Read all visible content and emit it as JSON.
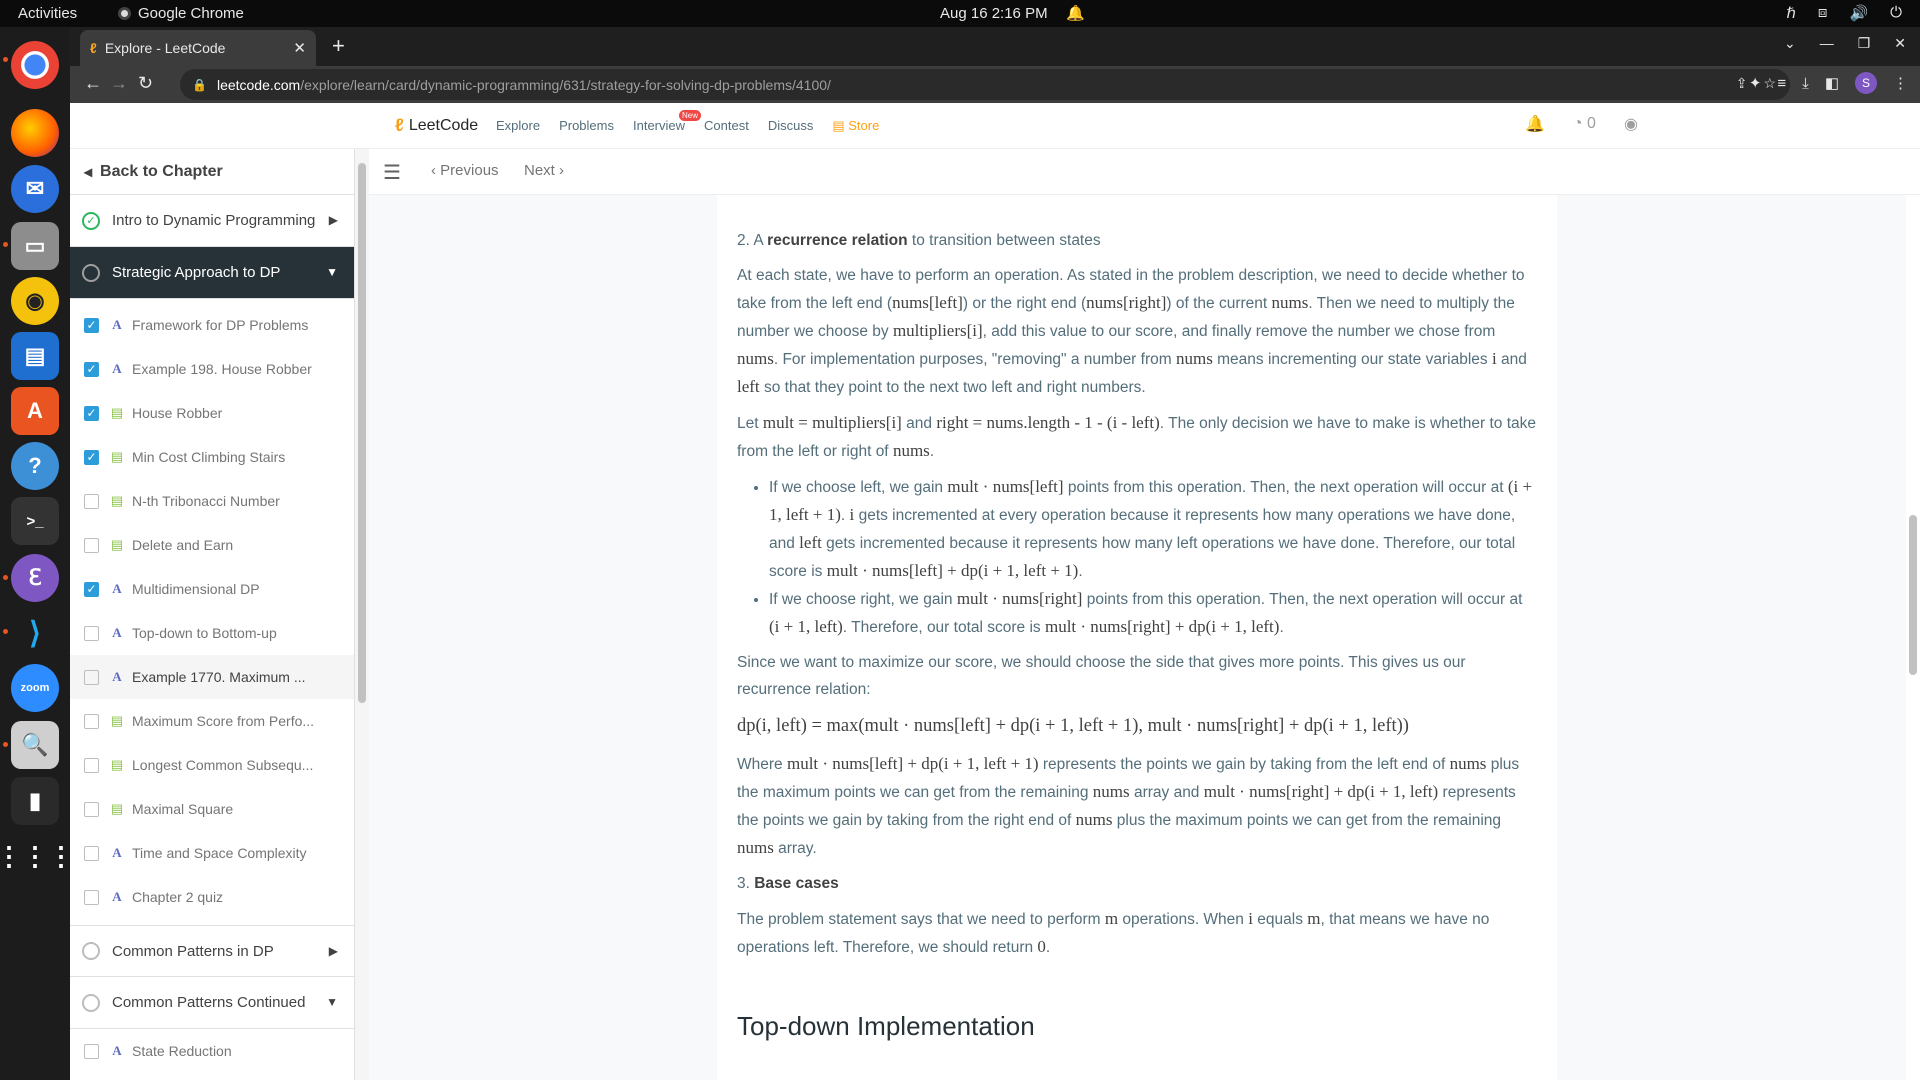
{
  "system": {
    "activities": "Activities",
    "app_name": "Google Chrome",
    "clock": "Aug 16  2:16 PM"
  },
  "browser": {
    "tab_title": "Explore - LeetCode",
    "url_host": "leetcode.com",
    "url_path": "/explore/learn/card/dynamic-programming/631/strategy-for-solving-dp-problems/4100/",
    "profile_initial": "S"
  },
  "lc_nav": {
    "logo": "LeetCode",
    "links": [
      "Explore",
      "Problems",
      "Interview",
      "Contest",
      "Discuss"
    ],
    "new_badge": "New",
    "store": "Store",
    "coin_count": "0"
  },
  "sidebar": {
    "back_label": "Back to Chapter",
    "chapters": [
      {
        "label": "Intro to Dynamic Programming",
        "status": "done",
        "expanded": false
      },
      {
        "label": "Strategic Approach to DP",
        "status": "in-progress",
        "expanded": true
      }
    ],
    "lessons": [
      {
        "label": "Framework for DP Problems",
        "checked": true,
        "type": "article"
      },
      {
        "label": "Example 198. House Robber",
        "checked": true,
        "type": "article"
      },
      {
        "label": "House Robber",
        "checked": true,
        "type": "doc"
      },
      {
        "label": "Min Cost Climbing Stairs",
        "checked": true,
        "type": "doc"
      },
      {
        "label": "N-th Tribonacci Number",
        "checked": false,
        "type": "doc"
      },
      {
        "label": "Delete and Earn",
        "checked": false,
        "type": "doc"
      },
      {
        "label": "Multidimensional DP",
        "checked": true,
        "type": "article"
      },
      {
        "label": "Top-down to Bottom-up",
        "checked": false,
        "type": "article"
      },
      {
        "label": "Example 1770. Maximum ...",
        "checked": false,
        "type": "article",
        "selected": true
      },
      {
        "label": "Maximum Score from Perfo...",
        "checked": false,
        "type": "doc"
      },
      {
        "label": "Longest Common Subsequ...",
        "checked": false,
        "type": "doc"
      },
      {
        "label": "Maximal Square",
        "checked": false,
        "type": "doc"
      },
      {
        "label": "Time and Space Complexity",
        "checked": false,
        "type": "article"
      },
      {
        "label": "Chapter 2 quiz",
        "checked": false,
        "type": "article"
      }
    ],
    "chapters_after": [
      {
        "label": "Common Patterns in DP",
        "expanded": false
      },
      {
        "label": "Common Patterns Continued",
        "expanded": true
      }
    ],
    "partial_lesson": "State Reduction"
  },
  "content_header": {
    "previous": "Previous",
    "next": "Next"
  },
  "article": {
    "rec_num": "2. A ",
    "rec_bold": "recurrence relation",
    "rec_rest": " to transition between states",
    "p1": [
      "At each state, we have to perform an operation. As stated in the problem description, we need to decide whether to take from the left end (",
      "nums[left]",
      ") or the right end (",
      "nums[right]",
      ") of the current ",
      "nums",
      ". Then we need to multiply the number we choose by ",
      "multipliers[i]",
      ", add this value to our score, and finally remove the number we chose from ",
      "nums",
      ". For implementation purposes, \"removing\" a number from ",
      "nums",
      " means incrementing our state variables ",
      "i",
      " and ",
      "left",
      " so that they point to the next two left and right numbers."
    ],
    "p2": [
      "Let ",
      "mult = multipliers[i]",
      " and ",
      "right = nums.length - 1 - (i - left)",
      ". The only decision we have to make is whether to take from the left or right of ",
      "nums",
      "."
    ],
    "bullet1": [
      "If we choose left, we gain ",
      "mult · nums[left]",
      " points from this operation. Then, the next operation will occur at ",
      "(i + 1, left + 1)",
      ". ",
      "i",
      " gets incremented at every operation because it represents how many operations we have done, and ",
      "left",
      " gets incremented because it represents how many left operations we have done. Therefore, our total score is ",
      "mult · nums[left] + dp(i + 1, left + 1)",
      "."
    ],
    "bullet2": [
      "If we choose right, we gain ",
      "mult · nums[right]",
      " points from this operation. Then, the next operation will occur at ",
      "(i + 1, left)",
      ". Therefore, our total score is ",
      "mult · nums[right] + dp(i + 1, left)",
      "."
    ],
    "p3": "Since we want to maximize our score, we should choose the side that gives more points. This gives us our recurrence relation:",
    "formula": "dp(i, left) = max(mult · nums[left] + dp(i + 1, left + 1),  mult · nums[right] + dp(i + 1, left))",
    "p4": [
      "Where ",
      "mult · nums[left] + dp(i + 1, left + 1)",
      " represents the points we gain by taking from the left end of ",
      "nums",
      " plus the maximum points we can get from the remaining ",
      "nums",
      " array and ",
      "mult · nums[right] + dp(i + 1, left)",
      " represents the points we gain by taking from the right end of ",
      "nums",
      " plus the maximum points we can get from the remaining ",
      "nums",
      " array."
    ],
    "base_num": "3. ",
    "base_bold": "Base cases",
    "p5": [
      "The problem statement says that we need to perform ",
      "m",
      " operations. When ",
      "i",
      " equals ",
      "m",
      ", that means we have no operations left. Therefore, we should return ",
      "0",
      "."
    ],
    "next_heading": "Top-down Implementation"
  },
  "colors": {
    "accent_orange": "#ffa116",
    "check_blue": "#2d9cdb",
    "done_green": "#2db55d",
    "active_chapter_bg": "#263238"
  }
}
